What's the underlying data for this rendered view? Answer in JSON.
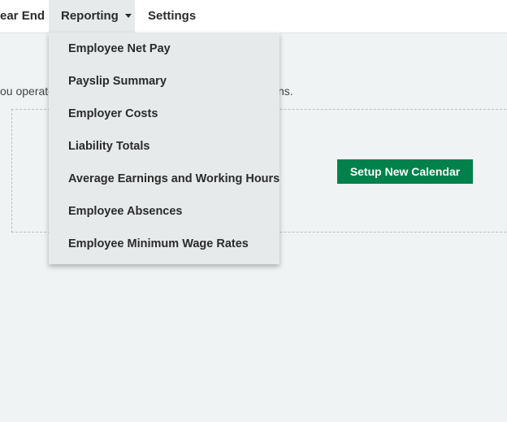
{
  "nav": {
    "year_end": "ear End",
    "reporting": "Reporting",
    "settings": "Settings"
  },
  "description": {
    "left": "ou operate",
    "right": "ns."
  },
  "setup_button": "Setup New Calendar",
  "reporting_menu": {
    "items": [
      "Employee Net Pay",
      "Payslip Summary",
      "Employer Costs",
      "Liability Totals",
      "Average Earnings and Working Hours",
      "Employee Absences",
      "Employee Minimum Wage Rates"
    ]
  },
  "colors": {
    "primary_button": "#00804a",
    "background": "#eff3f3",
    "menu_background": "#e6eaeb"
  }
}
